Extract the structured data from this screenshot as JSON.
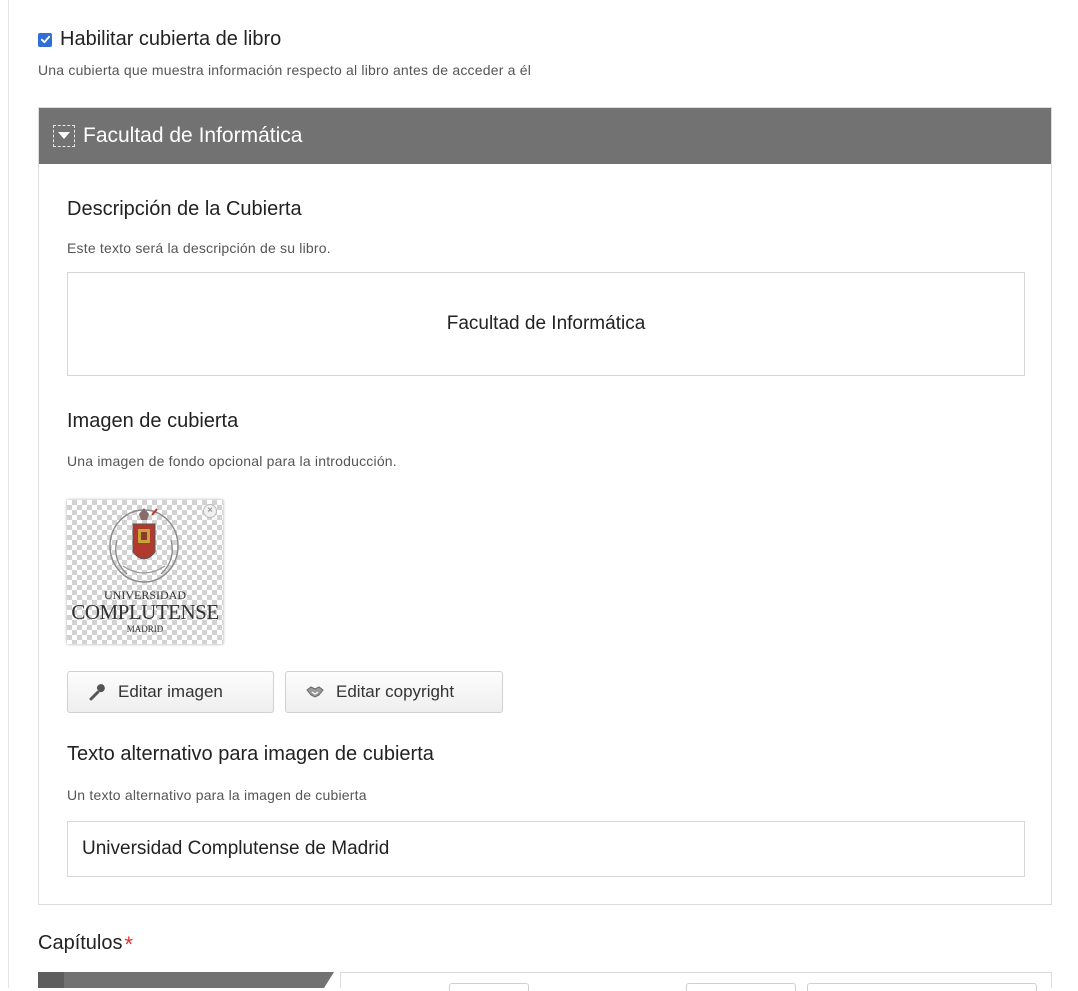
{
  "cover": {
    "enable_label": "Habilitar cubierta de libro",
    "enable_checked": true,
    "enable_description": "Una cubierta que muestra información respecto al libro antes de acceder a él"
  },
  "group": {
    "title": "Facultad de Informática",
    "toggle_icon": "caret-down-icon"
  },
  "cover_description": {
    "label": "Descripción de la Cubierta",
    "help": "Este texto será la descripción de su libro.",
    "value": "Facultad de Informática"
  },
  "cover_image": {
    "label": "Imagen de cubierta",
    "help": "Una imagen de fondo opcional para la introducción.",
    "logo_line1": "UNIVERSIDAD",
    "logo_line2": "COMPLUTENSE",
    "logo_line3": "MADRID",
    "remove_icon": "close-icon",
    "edit_image_label": "Editar imagen",
    "edit_image_icon": "wrench-icon",
    "edit_copyright_label": "Editar copyright",
    "edit_copyright_icon": "handshake-icon"
  },
  "alt_text": {
    "label": "Texto alternativo para imagen de cubierta",
    "help": "Un texto alternativo para la imagen de cubierta",
    "value": "Universidad Complutense de Madrid"
  },
  "chapters": {
    "label": "Capítulos",
    "required_mark": "*"
  },
  "colors": {
    "header_bg": "#737273",
    "checkbox": "#2f6fd6",
    "required": "#dd3333"
  }
}
